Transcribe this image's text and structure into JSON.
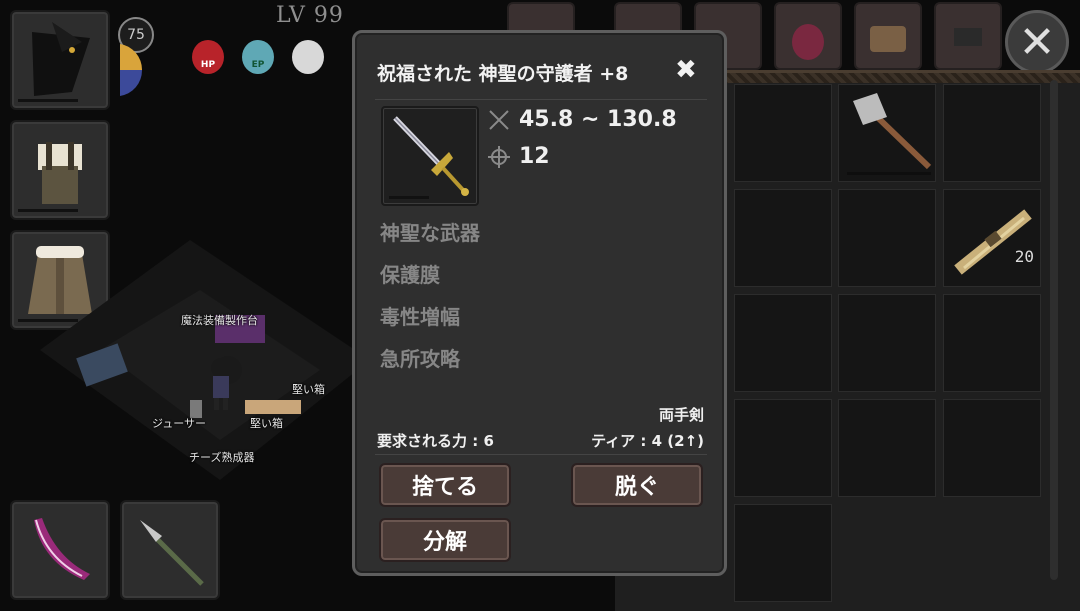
{
  "hud": {
    "level": "LV 99",
    "level_badge": "75",
    "orbs": [
      {
        "label": "HP",
        "color": "#b8232a"
      },
      {
        "label": "EP",
        "color": "#5fa8b5"
      },
      {
        "label": "",
        "color": "#d8d8d8"
      }
    ]
  },
  "map_labels": {
    "crafting_table": "魔法装備製作台",
    "sturdy_box_1": "堅い箱",
    "sturdy_box_2": "堅い箱",
    "juicer": "ジューサー",
    "cheese_aging": "チーズ熟成器"
  },
  "item_popup": {
    "title": "祝福された 神聖の守護者 +8",
    "close_symbol": "✖",
    "damage": "45.8 ~ 130.8",
    "accuracy": "12",
    "enchantments": [
      "神聖な武器",
      "保護膜",
      "毒性増幅",
      "急所攻略"
    ],
    "weapon_type": "両手剣",
    "required_strength": "要求される力 : 6",
    "tier": "ティア : 4 (2↑)",
    "buttons": {
      "discard": "捨てる",
      "unequip": "脱ぐ",
      "disassemble": "分解"
    }
  },
  "inventory": {
    "grass_count": "20"
  },
  "colors": {
    "panel_bg": "#2f2f2f",
    "button_bg": "#4a3b37",
    "muted_text": "#868686"
  }
}
